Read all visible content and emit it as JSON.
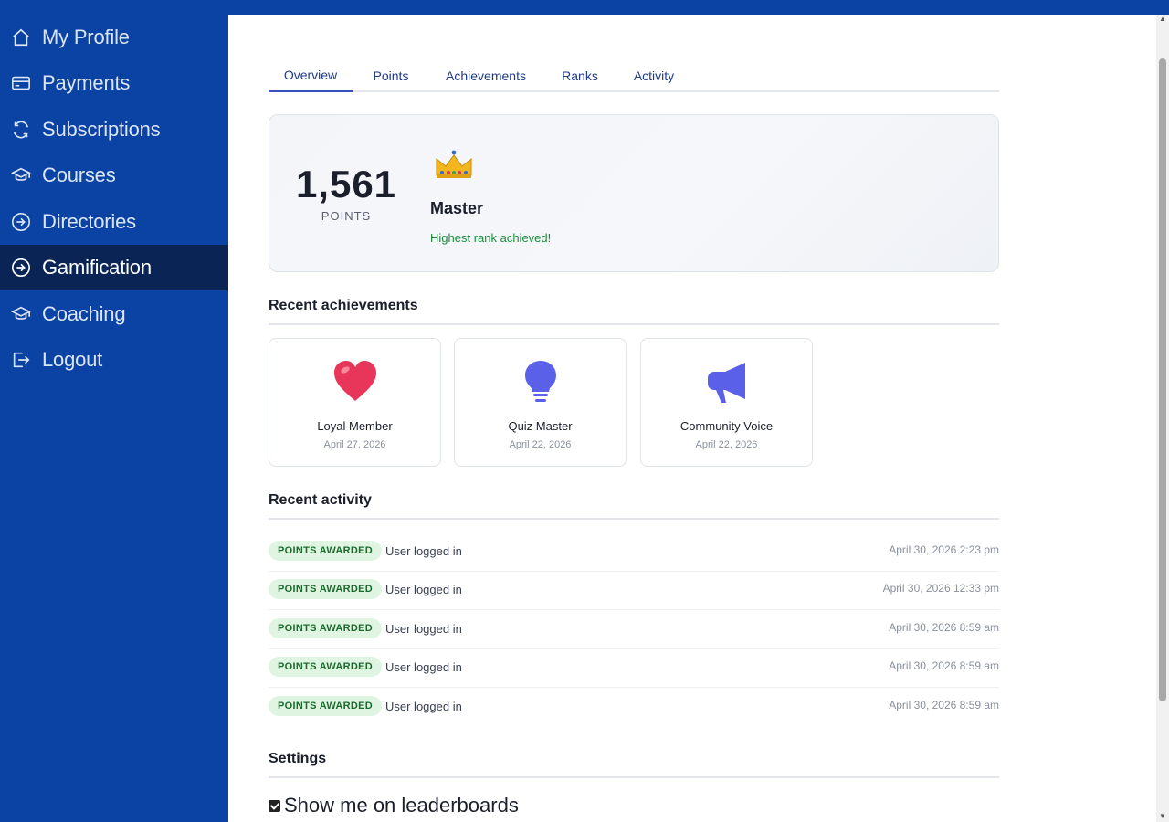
{
  "sidebar": {
    "items": [
      {
        "label": "My Profile",
        "icon": "home-icon"
      },
      {
        "label": "Payments",
        "icon": "credit-card-icon"
      },
      {
        "label": "Subscriptions",
        "icon": "refresh-icon"
      },
      {
        "label": "Courses",
        "icon": "graduation-cap-icon"
      },
      {
        "label": "Directories",
        "icon": "arrow-circle-right-icon"
      },
      {
        "label": "Gamification",
        "icon": "arrow-circle-right-icon",
        "active": true
      },
      {
        "label": "Coaching",
        "icon": "graduation-cap-icon"
      },
      {
        "label": "Logout",
        "icon": "logout-icon"
      }
    ]
  },
  "tabs": [
    {
      "label": "Overview",
      "active": true
    },
    {
      "label": "Points"
    },
    {
      "label": "Achievements"
    },
    {
      "label": "Ranks"
    },
    {
      "label": "Activity"
    }
  ],
  "summary": {
    "points_value": "1,561",
    "points_label": "POINTS",
    "rank_icon": "crown-icon",
    "rank_name": "Master",
    "rank_note": "Highest rank achieved!"
  },
  "achievements": {
    "title": "Recent achievements",
    "items": [
      {
        "name": "Loyal Member",
        "date": "April 27, 2026",
        "icon": "heart-icon",
        "color": "#e8365a"
      },
      {
        "name": "Quiz Master",
        "date": "April 22, 2026",
        "icon": "lightbulb-icon",
        "color": "#5b60e8"
      },
      {
        "name": "Community Voice",
        "date": "April 22, 2026",
        "icon": "megaphone-icon",
        "color": "#5b60e8"
      }
    ]
  },
  "activity": {
    "title": "Recent activity",
    "rows": [
      {
        "badge": "POINTS AWARDED",
        "text": "User logged in",
        "time": "April 30, 2026 2:23 pm"
      },
      {
        "badge": "POINTS AWARDED",
        "text": "User logged in",
        "time": "April 30, 2026 12:33 pm"
      },
      {
        "badge": "POINTS AWARDED",
        "text": "User logged in",
        "time": "April 30, 2026 8:59 am"
      },
      {
        "badge": "POINTS AWARDED",
        "text": "User logged in",
        "time": "April 30, 2026 8:59 am"
      },
      {
        "badge": "POINTS AWARDED",
        "text": "User logged in",
        "time": "April 30, 2026 8:59 am"
      }
    ]
  },
  "settings": {
    "title": "Settings",
    "leaderboard_label": "Show me on leaderboards",
    "leaderboard_checked": true
  },
  "colors": {
    "sidebar_bg": "#0a43a3",
    "sidebar_active": "#0b2456",
    "accent": "#3a4fc4",
    "badge_bg": "#dff5e1",
    "badge_text": "#1b6b2d",
    "success_text": "#1a8a3a"
  }
}
